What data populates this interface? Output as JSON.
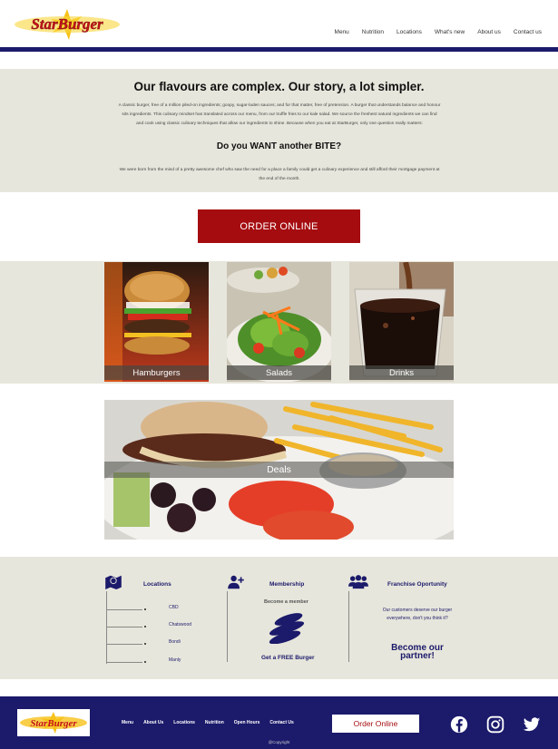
{
  "brand": {
    "name": "StarBurger"
  },
  "nav": [
    "Menu",
    "Nutrition",
    "Locations",
    "What's new",
    "About us",
    "Contact us"
  ],
  "intro": {
    "heading": "Our flavours are complex. Our story, a lot simpler.",
    "para1_line1": "A classic burger, free of a million piled-on ingredients; goopy, sugar-laden sauces; and for that matter, free of pretension. A burger that understands balance and honour",
    "para1_line2": "sits ingredients. This culinary mindset has translated across our menu, from our truffle fries to our kale salad. We source the freshest natural ingredients we can find",
    "para1_line3": "and cook using classic culinary techniques that allow our ingredients to shine. Because when you eat at StarBurger, only one question really matters:",
    "subheading": "Do you WANT another BITE?",
    "para2_line1": "We were born from the mind of a pretty awesome chef who saw the need for a place a family could get a culinary experience and still afford their mortgage payment at",
    "para2_line2": "the end of the month."
  },
  "order_label": "ORDER ONLINE",
  "categories": [
    "Hamburgers",
    "Salads",
    "Drinks"
  ],
  "deals_label": "Deals",
  "social_icons": [
    "facebook-icon",
    "instagram-icon",
    "twitter-icon"
  ],
  "info": {
    "locations": {
      "title": "Locations",
      "items": [
        "CBD",
        "Chatswood",
        "Bondi",
        "Manly"
      ]
    },
    "membership": {
      "title": "Membership",
      "subtitle": "Become a member",
      "cta": "Get a FREE Burger"
    },
    "franchise": {
      "title": "Franchise Oportunity",
      "text_line1": "Our customers deserve our burger",
      "text_line2": "everywhere, don't you think it?",
      "cta_line1": "Become our",
      "cta_line2": "partner!"
    }
  },
  "footer": {
    "nav": [
      "Menu",
      "About Us",
      "Locations",
      "Nutrition",
      "Open Hours",
      "Contact Us"
    ],
    "order_label": "Order Online",
    "copyright": "@Copyright"
  },
  "colors": {
    "brand_red": "#a50c10",
    "navy": "#1b1a6b",
    "band": "#e7e6dc"
  }
}
